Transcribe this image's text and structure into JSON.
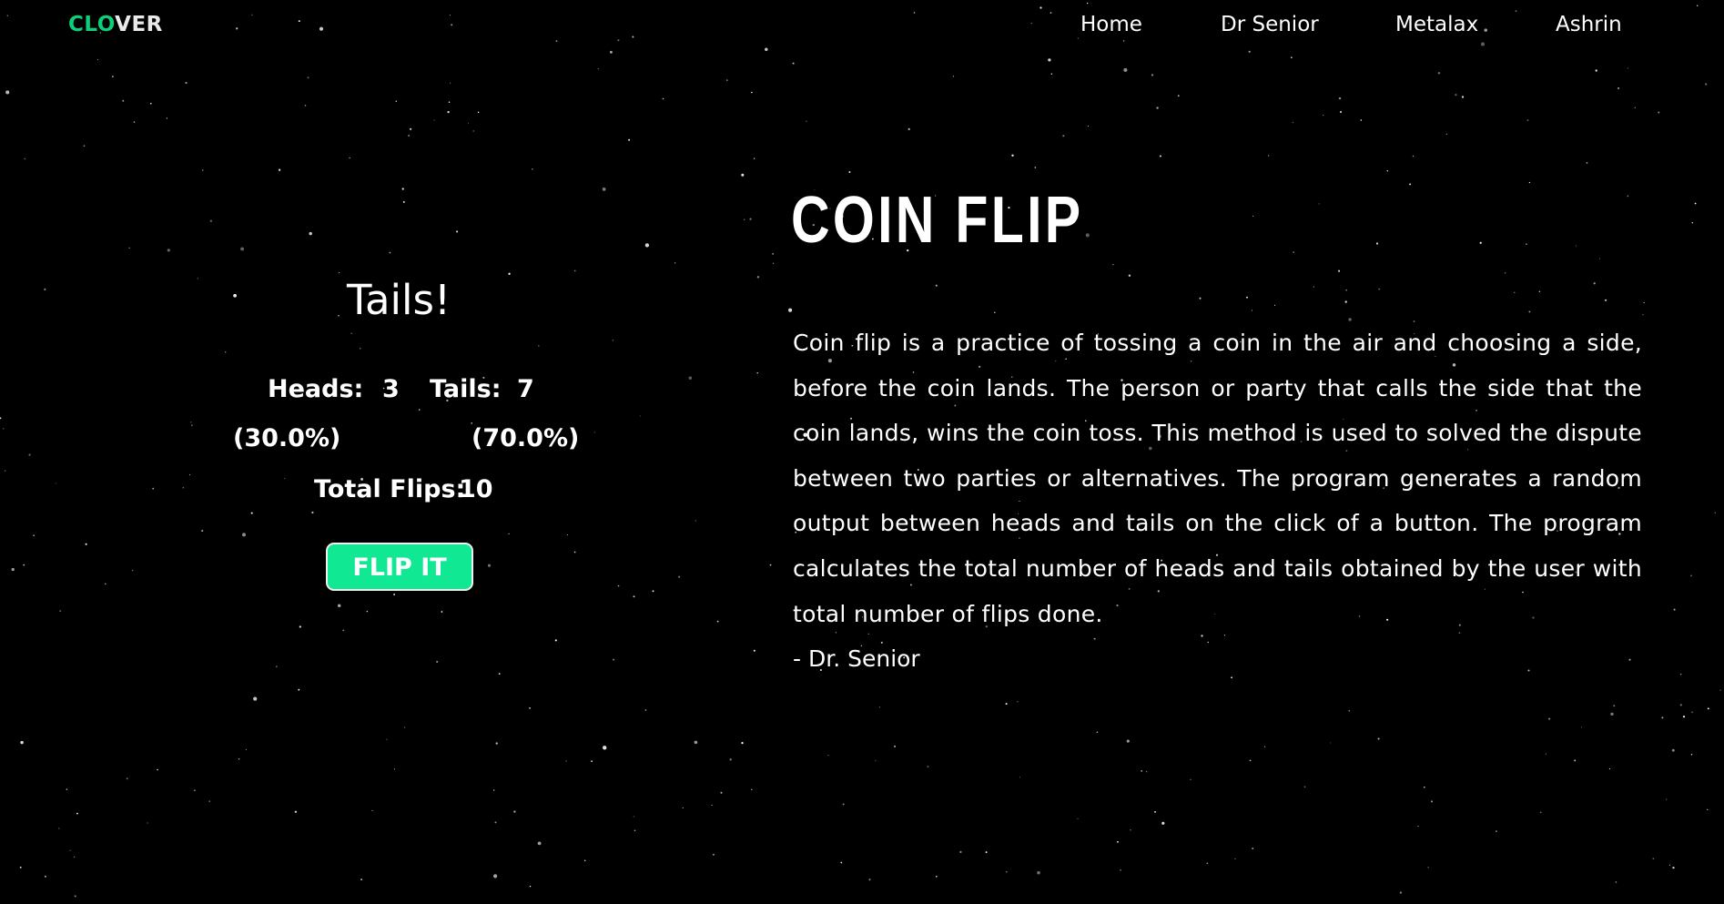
{
  "brand": {
    "logo_part1": "CLO",
    "logo_part2": "VER",
    "accent_color": "#0ccf7a"
  },
  "nav": {
    "items": [
      {
        "label": "Home"
      },
      {
        "label": "Dr Senior"
      },
      {
        "label": "Metalax"
      },
      {
        "label": "Ashrin"
      }
    ]
  },
  "game": {
    "result": "Tails!",
    "heads_label": "Heads:",
    "heads_count": "3",
    "tails_label": "Tails:",
    "tails_count": "7",
    "heads_percent": "(30.0%)",
    "tails_percent": "(70.0%)",
    "total_label": "Total Flips:",
    "total_count": "10",
    "button_label": "FLIP IT",
    "button_color": "#10e894"
  },
  "article": {
    "title": "COIN FLIP",
    "description": "Coin flip is a practice of tossing a coin in the air and choosing a side, before the coin lands. The person or party that calls the side that the coin lands, wins the coin toss. This method is used to solved the dispute between two parties or alternatives. The program generates a random output between heads and tails on the click of a button. The program calculates the total number of heads and tails obtained by the user with total number of flips done.",
    "author": "- Dr. Senior"
  }
}
